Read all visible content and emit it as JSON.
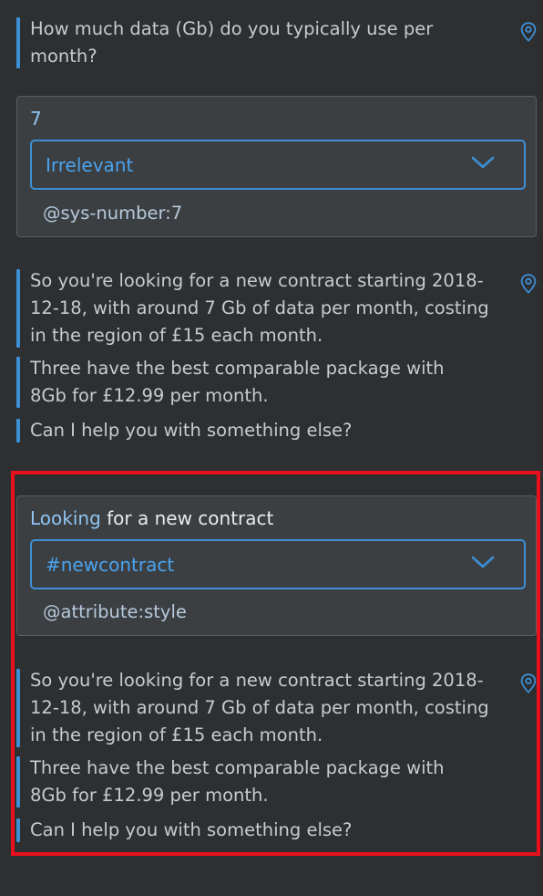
{
  "messages": {
    "q_data": "How much data (Gb) do you typically use per month?",
    "summary_1": "So you're looking for a new contract starting 2018-12-18, with around 7 Gb of data per month, costing in the region of £15 each month.",
    "offer_1": "Three have the best comparable package with 8Gb for £12.99 per month.",
    "help_1": "Can I help you with something else?",
    "summary_2": "So you're looking for a new contract starting 2018-12-18, with around 7 Gb of data per month, costing in the region of £15 each month.",
    "offer_2": "Three have the best comparable package with 8Gb for £12.99 per month.",
    "help_2": "Can I help you with something else?"
  },
  "card_1": {
    "input": "7",
    "intent": "Irrelevant",
    "entity": "@sys-number:7"
  },
  "card_2": {
    "input_highlight": "Looking",
    "input_rest": " for a new contract",
    "intent": "#newcontract",
    "entity": "@attribute:style"
  },
  "colors": {
    "accent": "#3d8fd6",
    "background": "#2d2f31",
    "highlight_frame": "#e8101c"
  },
  "icons": {
    "location": "location-pin-icon",
    "dropdown": "chevron-down-icon"
  }
}
